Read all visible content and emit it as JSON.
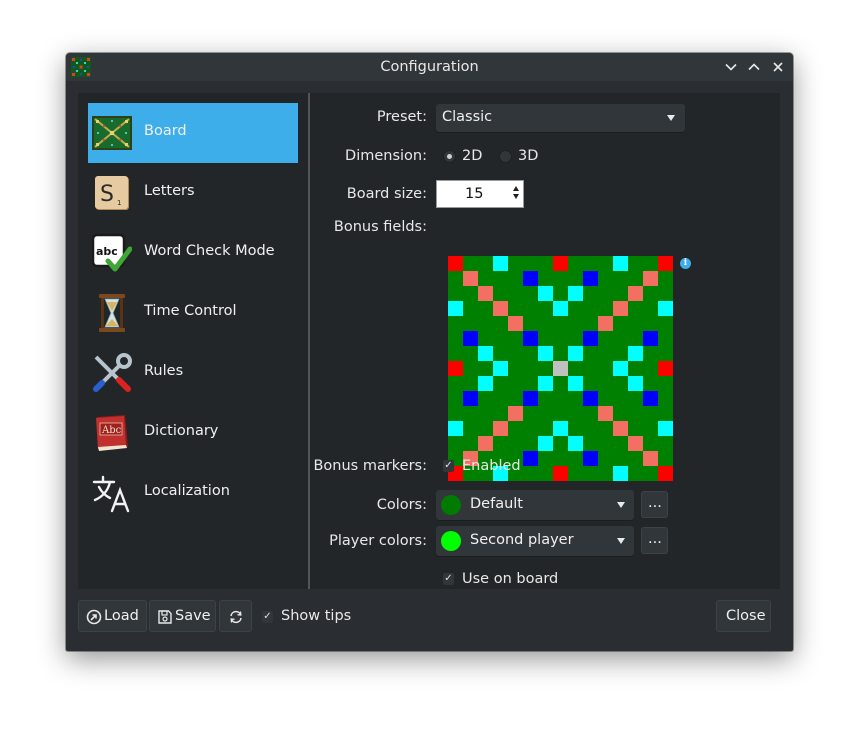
{
  "window": {
    "title": "Configuration"
  },
  "sidebar": {
    "items": [
      {
        "label": "Board",
        "icon": "scrabble-board-icon",
        "selected": true
      },
      {
        "label": "Letters",
        "icon": "letter-tile-icon"
      },
      {
        "label": "Word Check Mode",
        "icon": "abc-check-icon"
      },
      {
        "label": "Time Control",
        "icon": "hourglass-icon"
      },
      {
        "label": "Rules",
        "icon": "tools-icon"
      },
      {
        "label": "Dictionary",
        "icon": "dictionary-book-icon"
      },
      {
        "label": "Localization",
        "icon": "translate-icon"
      }
    ]
  },
  "form": {
    "preset_label": "Preset:",
    "preset_value": "Classic",
    "dimension_label": "Dimension:",
    "dimension_options": [
      "2D",
      "3D"
    ],
    "dimension_selected": "2D",
    "board_size_label": "Board size:",
    "board_size_value": "15",
    "bonus_fields_label": "Bonus fields:",
    "bonus_markers_label": "Bonus markers:",
    "bonus_markers_text": "Enabled",
    "bonus_markers_checked": true,
    "colors_label": "Colors:",
    "colors_value": "Default",
    "colors_swatch": "#007a00",
    "colors_more": "...",
    "player_colors_label": "Player colors:",
    "player_colors_value": "Second player",
    "player_colors_swatch": "#00ff00",
    "player_colors_more": "...",
    "use_on_board_text": "Use on board",
    "use_on_board_checked": true
  },
  "board": {
    "size": 15,
    "base_color": "#008000",
    "colors": {
      "red": "#ff0000",
      "salmon": "#f26f62",
      "cyan": "#00ffff",
      "blue": "#0000ff",
      "grey": "#c0c0c0"
    },
    "rows": [
      "R..C...R...C..R",
      ".S...B...B...S.",
      "..S...C.C...S..",
      "C..S...C...S..C",
      "....S.....S....",
      ".B...B...B...B.",
      "..C...C.C...C..",
      "R..C...X...C..R",
      "..C...C.C...C..",
      ".B...B...B...B.",
      "....S.....S....",
      "C..S...C...S..C",
      "..S...C.C...S..",
      ".S...B...B...S.",
      "R..C...R...C..R"
    ]
  },
  "footer": {
    "load_label": "Load",
    "save_label": "Save",
    "show_tips_text": "Show tips",
    "show_tips_checked": true,
    "close_label": "Close"
  }
}
